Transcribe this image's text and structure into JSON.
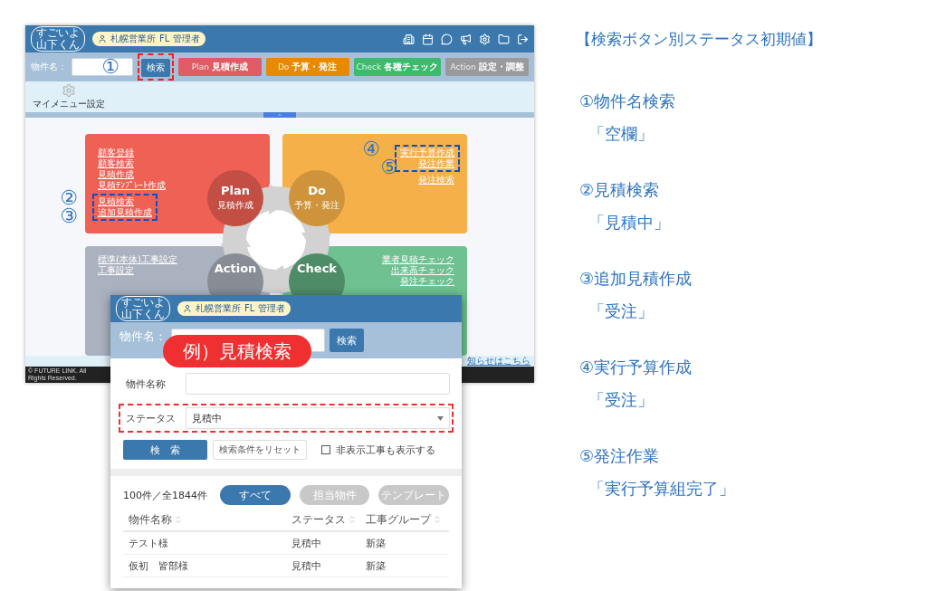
{
  "main_window": {
    "logo": [
      "すごいよ",
      "山下くん"
    ],
    "user_badge": {
      "office": "札幌営業所",
      "role": "FL 管理者"
    },
    "toolbar": {
      "label": "物件名：",
      "search_button": {
        "label": "検索",
        "highlighted": true,
        "marker": "①"
      },
      "phases": [
        {
          "name": "Plan",
          "label": "見積作成",
          "color": "#e05c64"
        },
        {
          "name": "Do",
          "label": "予算・発注",
          "color": "#e68a00"
        },
        {
          "name": "Check",
          "label": "各種チェック",
          "color": "#3dbb6c"
        },
        {
          "name": "Action",
          "label": "設定・調整",
          "color": "#9a9a9a"
        }
      ]
    },
    "my_menu": "マイメニュー設定",
    "cards": [
      {
        "color": "#ef6055",
        "links": [
          {
            "label": "顧客登録",
            "highlighted": false
          },
          {
            "label": "顧客検索",
            "highlighted": false
          },
          {
            "label": "見積作成",
            "highlighted": false
          },
          {
            "label": "見積ﾃﾝﾌﾟﾚｰﾄ作成",
            "highlighted": false
          },
          {
            "label": "見積検索",
            "highlighted": true,
            "marker": "②"
          },
          {
            "label": "追加見積作成",
            "highlighted": true,
            "marker": "③"
          }
        ]
      },
      {
        "color": "#f5b04a",
        "links": [
          {
            "label": "実行予算作成",
            "highlighted": true,
            "marker": "④"
          },
          {
            "label": "発注作業",
            "highlighted": true,
            "marker": "⑤"
          },
          {
            "label": "発注検索",
            "highlighted": false
          }
        ]
      },
      {
        "color": "#abb2bf",
        "links": [
          {
            "label": "標準(本体)工事設定",
            "highlighted": false
          },
          {
            "label": "工事設定",
            "highlighted": false
          }
        ]
      },
      {
        "color": "#6fc191",
        "links": [
          {
            "label": "業者見積チェック",
            "highlighted": false
          },
          {
            "label": "出来高チェック",
            "highlighted": false
          },
          {
            "label": "発注チェック",
            "highlighted": false
          }
        ]
      }
    ],
    "cycle": [
      {
        "name": "Plan",
        "label": "見積作成",
        "color": "#c24e44"
      },
      {
        "name": "Do",
        "label": "予算・発注",
        "color": "#cf943b"
      },
      {
        "name": "Action",
        "color": "#888c94"
      },
      {
        "name": "Check",
        "color": "#4e8c68"
      }
    ],
    "notice_link": "知らせはこちら",
    "copyright": "© FUTURE LINK. All Rights Reserved."
  },
  "callout": "例）見積検索",
  "detail_window": {
    "logo": [
      "すごいよ",
      "山下くん"
    ],
    "user_badge": {
      "office": "札幌営業所",
      "role": "FL 管理者"
    },
    "toolbar": {
      "label": "物件名：",
      "search_button": "検索"
    },
    "form": {
      "fields": [
        {
          "kind": "text",
          "label": "物件名称",
          "highlighted": false
        },
        {
          "kind": "select",
          "label": "ステータス",
          "value": "見積中",
          "highlighted": true
        }
      ],
      "search_button": "検　索",
      "reset_button": "検索条件をリセット",
      "show_hidden": {
        "label": "非表示工事も表示する",
        "checked": false
      }
    },
    "results": {
      "count": "100件／全1844件",
      "tabs": [
        {
          "label": "すべて",
          "selected": true
        },
        {
          "label": "担当物件",
          "selected": false
        },
        {
          "label": "テンプレート",
          "selected": false
        }
      ],
      "columns": [
        "物件名称",
        "ステータス",
        "工事グループ"
      ],
      "rows": [
        [
          "テスト様",
          "見積中",
          "新築"
        ],
        [
          "仮初　皆部様",
          "見積中",
          "新築"
        ]
      ]
    }
  },
  "notes": {
    "title": "【検索ボタン別ステータス初期値】",
    "items": [
      {
        "heading": "①物件名検索",
        "value": "「空欄」"
      },
      {
        "heading": "②見積検索",
        "value": "「見積中」"
      },
      {
        "heading": "③追加見積作成",
        "value": "「受注」"
      },
      {
        "heading": "④実行予算作成",
        "value": "「受注」"
      },
      {
        "heading": "⑤発注作業",
        "value": "「実行予算組完了」"
      }
    ]
  }
}
